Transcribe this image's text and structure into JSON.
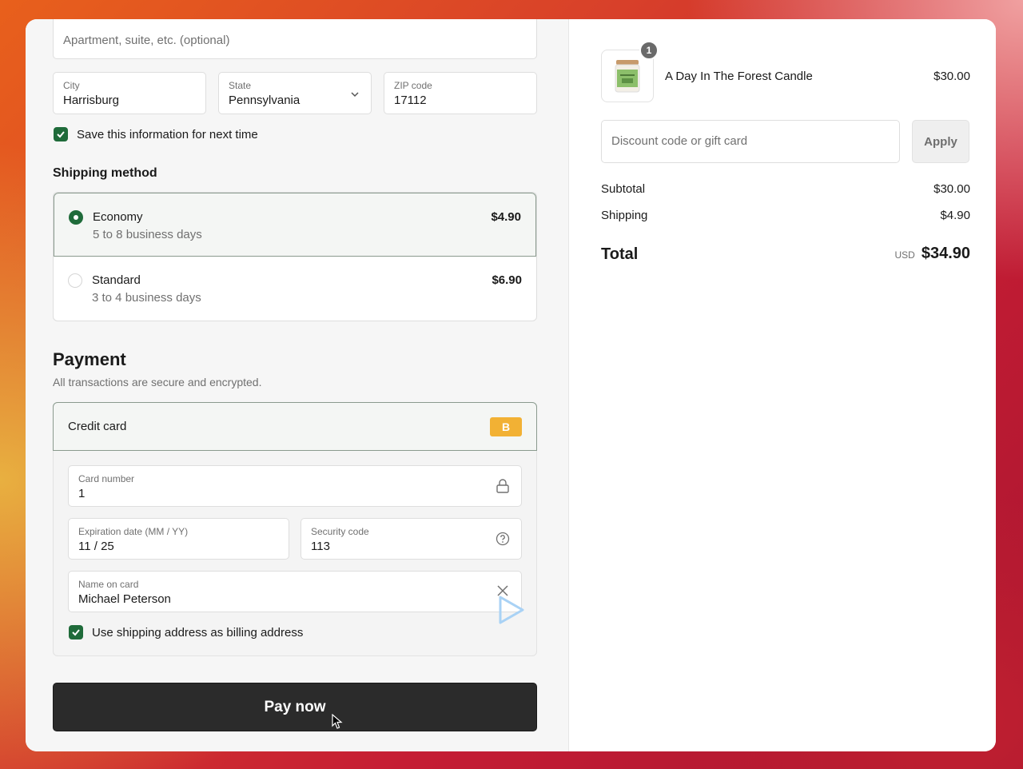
{
  "address": {
    "apartment_placeholder": "Apartment, suite, etc. (optional)",
    "city_label": "City",
    "city_value": "Harrisburg",
    "state_label": "State",
    "state_value": "Pennsylvania",
    "zip_label": "ZIP code",
    "zip_value": "17112",
    "save_info_label": "Save this information for next time"
  },
  "shipping": {
    "title": "Shipping method",
    "options": [
      {
        "name": "Economy",
        "sub": "5 to 8 business days",
        "price": "$4.90",
        "selected": true
      },
      {
        "name": "Standard",
        "sub": "3 to 4 business days",
        "price": "$6.90",
        "selected": false
      }
    ]
  },
  "payment": {
    "title": "Payment",
    "subtitle": "All transactions are secure and encrypted.",
    "method_label": "Credit card",
    "badge": "B",
    "card_number_label": "Card number",
    "card_number_value": "1",
    "expiry_label": "Expiration date (MM / YY)",
    "expiry_value": "11 / 25",
    "security_label": "Security code",
    "security_value": "113",
    "name_label": "Name on card",
    "name_value": "Michael Peterson",
    "billing_label": "Use shipping address as billing address",
    "pay_button": "Pay now"
  },
  "summary": {
    "quantity": "1",
    "product_name": "A Day In The Forest Candle",
    "product_price": "$30.00",
    "discount_placeholder": "Discount code or gift card",
    "apply_label": "Apply",
    "subtotal_label": "Subtotal",
    "subtotal_value": "$30.00",
    "shipping_label": "Shipping",
    "shipping_value": "$4.90",
    "total_label": "Total",
    "currency": "USD",
    "total_value": "$34.90"
  },
  "icons": {
    "chevron": "chevron-down-icon",
    "lock": "lock-icon",
    "help": "help-circle-icon",
    "close": "close-icon",
    "check": "check-icon"
  },
  "colors": {
    "accent_green": "#1f6b3a",
    "badge_yellow": "#f2b134",
    "pay_button_bg": "#2b2b2b"
  }
}
